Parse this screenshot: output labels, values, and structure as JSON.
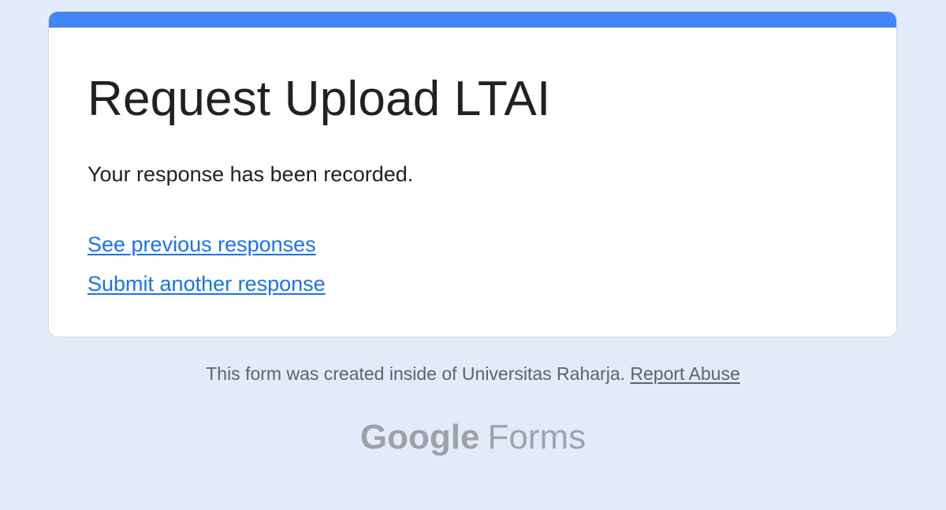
{
  "form": {
    "title": "Request Upload LTAI",
    "confirmation_message": "Your response has been recorded.",
    "links": {
      "previous_responses": "See previous responses",
      "submit_another": "Submit another response"
    }
  },
  "footer": {
    "notice": "This form was created inside of Universitas Raharja.",
    "report_abuse": "Report Abuse"
  },
  "branding": {
    "google": "Google",
    "forms": "Forms"
  },
  "colors": {
    "page_background": "#e3ebfb",
    "accent": "#4285f4",
    "link": "#1a73e8"
  }
}
